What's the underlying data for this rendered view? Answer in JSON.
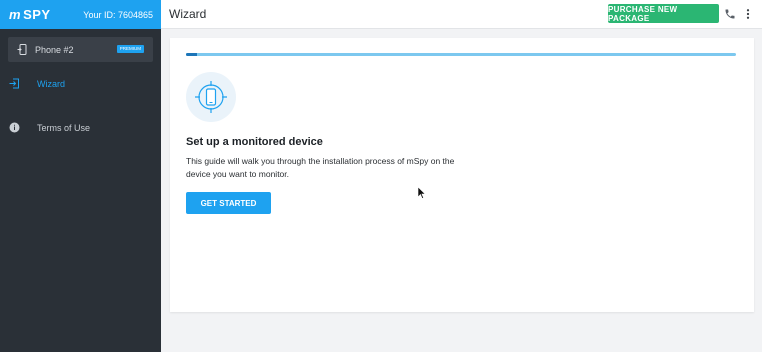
{
  "brand": {
    "logo_text": "SPY",
    "logo_prefix": "m",
    "user_id": "Your ID: 7604865"
  },
  "header": {
    "title": "Wizard",
    "purchase_label": "PURCHASE NEW PACKAGE"
  },
  "sidebar": {
    "device": {
      "label": "Phone #2",
      "badge": "PREMIUM"
    },
    "items": [
      {
        "label": "Wizard",
        "icon": "login-arrow-icon",
        "active": true
      },
      {
        "label": "Terms of Use",
        "icon": "info-icon",
        "active": false
      }
    ]
  },
  "main": {
    "progress": 0.02,
    "heading": "Set up a monitored device",
    "description": "This guide will walk you through the installation process of mSpy on the device you want to monitor.",
    "start_label": "GET STARTED"
  },
  "colors": {
    "accent": "#1ea2f0",
    "purchase": "#2bb673",
    "sidebar": "#2a3037",
    "progress_track": "#7cc8ef",
    "progress_fill": "#1c75b8"
  }
}
